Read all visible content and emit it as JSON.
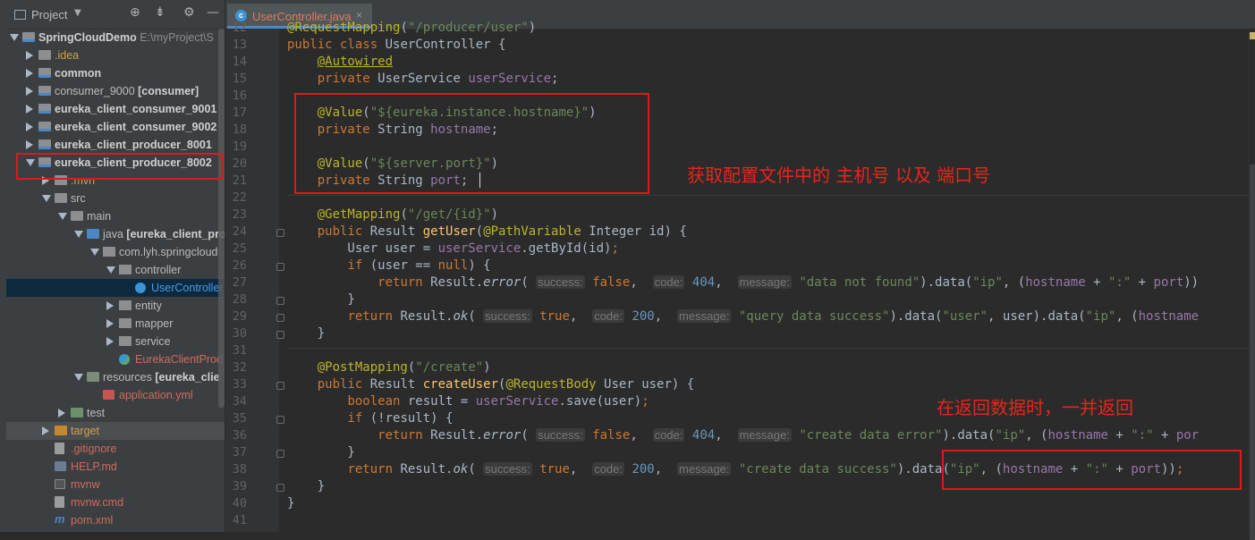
{
  "panel": {
    "title": "Project",
    "dropdown_icon": "chevron-down-icon",
    "toolbar_icons": [
      "crosshair-icon",
      "collapse-icon",
      "gear-icon",
      "minimize-icon"
    ]
  },
  "tree": [
    {
      "label": "SpringCloudDemo",
      "extra": " E:\\myProject\\S",
      "bold": true,
      "depth": 0,
      "arrow": "down",
      "icon": "module"
    },
    {
      "label": ".idea",
      "depth": 1,
      "arrow": "right",
      "icon": "folder",
      "color": "orange"
    },
    {
      "label": "common",
      "depth": 1,
      "arrow": "right",
      "icon": "module",
      "bold": true
    },
    {
      "label": "consumer_9000",
      "extra": " [consumer]",
      "depth": 1,
      "arrow": "right",
      "icon": "module"
    },
    {
      "label": "eureka_client_consumer_9001",
      "depth": 1,
      "arrow": "right",
      "icon": "module",
      "bold": true
    },
    {
      "label": "eureka_client_consumer_9002",
      "depth": 1,
      "arrow": "right",
      "icon": "module",
      "bold": true
    },
    {
      "label": "eureka_client_producer_8001",
      "depth": 1,
      "arrow": "right",
      "icon": "module",
      "bold": true
    },
    {
      "label": "eureka_client_producer_8002",
      "depth": 1,
      "arrow": "down",
      "icon": "module",
      "bold": true
    },
    {
      "label": ".mvn",
      "depth": 2,
      "arrow": "right",
      "icon": "folder",
      "color": "orange"
    },
    {
      "label": "src",
      "depth": 2,
      "arrow": "down",
      "icon": "folder"
    },
    {
      "label": "main",
      "depth": 3,
      "arrow": "down",
      "icon": "folder"
    },
    {
      "label": "java",
      "extra": " [eureka_client_pro",
      "depth": 4,
      "arrow": "down",
      "icon": "src"
    },
    {
      "label": "com.lyh.springcloud",
      "depth": 5,
      "arrow": "down",
      "icon": "pkg"
    },
    {
      "label": "controller",
      "depth": 6,
      "arrow": "down",
      "icon": "pkg"
    },
    {
      "label": "UserController",
      "depth": 7,
      "arrow": "none",
      "icon": "cls",
      "color": "sel",
      "selected": true
    },
    {
      "label": "entity",
      "depth": 6,
      "arrow": "right",
      "icon": "pkg"
    },
    {
      "label": "mapper",
      "depth": 6,
      "arrow": "right",
      "icon": "pkg"
    },
    {
      "label": "service",
      "depth": 6,
      "arrow": "right",
      "icon": "pkg"
    },
    {
      "label": "EurekaClientProd",
      "depth": 6,
      "arrow": "none",
      "icon": "app",
      "color": "red"
    },
    {
      "label": "resources",
      "extra": " [eureka_clie",
      "depth": 4,
      "arrow": "down",
      "icon": "res"
    },
    {
      "label": "application.yml",
      "depth": 5,
      "arrow": "none",
      "icon": "yml",
      "color": "red"
    },
    {
      "label": "test",
      "depth": 3,
      "arrow": "right",
      "icon": "test"
    },
    {
      "label": "target",
      "depth": 2,
      "arrow": "right",
      "icon": "target",
      "color": "orange",
      "highlight": true
    },
    {
      "label": ".gitignore",
      "depth": 2,
      "arrow": "none",
      "icon": "file",
      "color": "red"
    },
    {
      "label": "HELP.md",
      "depth": 2,
      "arrow": "none",
      "icon": "md",
      "color": "red"
    },
    {
      "label": "mvnw",
      "depth": 2,
      "arrow": "none",
      "icon": "term",
      "color": "red"
    },
    {
      "label": "mvnw.cmd",
      "depth": 2,
      "arrow": "none",
      "icon": "file",
      "color": "red"
    },
    {
      "label": "pom.xml",
      "depth": 2,
      "arrow": "none",
      "icon": "mvn",
      "color": "red"
    }
  ],
  "editor": {
    "tab": {
      "label": "UserController.java",
      "close": "×",
      "icon_letter": "c"
    },
    "lines": [
      {
        "n": "12",
        "html": "<span class=\"an\">@RequestMapping</span>(<span class=\"st\">\"/producer/user\"</span>)"
      },
      {
        "n": "13",
        "html": "<span class=\"kw\">public class</span> UserController {"
      },
      {
        "n": "14",
        "html": "    <span class=\"an underl\">@Autowired</span>"
      },
      {
        "n": "15",
        "html": "    <span class=\"kw\">private</span> UserService <span class=\"fd\">userService</span>;"
      },
      {
        "n": "16",
        "html": ""
      },
      {
        "n": "17",
        "html": "    <span class=\"an\">@Value</span>(<span class=\"st\">\"${eureka.instance.hostname}\"</span>)"
      },
      {
        "n": "18",
        "html": "    <span class=\"kw\">private</span> String <span class=\"fd\">hostname</span>;"
      },
      {
        "n": "19",
        "html": ""
      },
      {
        "n": "20",
        "html": "    <span class=\"an\">@Value</span>(<span class=\"st\">\"${server.port}\"</span>)"
      },
      {
        "n": "21",
        "html": "    <span class=\"kw\">private</span> String <span class=\"fd\">port</span>;"
      },
      {
        "n": "22",
        "html": ""
      },
      {
        "n": "23",
        "html": "    <span class=\"an\">@GetMapping</span>(<span class=\"st\">\"/get/{id}\"</span>)"
      },
      {
        "n": "24",
        "html": "    <span class=\"kw\">public</span> Result <span class=\"fn\">getUser</span>(<span class=\"an\">@PathVariable</span> Integer id) {"
      },
      {
        "n": "25",
        "html": "        User user = <span class=\"fd\">userService</span>.getById(id)<span class=\"kw\">;</span>"
      },
      {
        "n": "26",
        "html": "        <span class=\"kw\">if</span> (user == <span class=\"kw\">null</span>) {"
      },
      {
        "n": "27",
        "html": "            <span class=\"kw\">return</span> Result.<span class=\"it\">error</span>( <span class=\"hint\">success:</span> <span class=\"kw\">false</span>,  <span class=\"hint\">code:</span> <span class=\"nu\">404</span>,  <span class=\"hint\">message:</span> <span class=\"st\">\"data not found\"</span>).data(<span class=\"st\">\"ip\"</span>, (<span class=\"fd\">hostname</span> + <span class=\"st\">\":\"</span> + <span class=\"fd\">port</span>))"
      },
      {
        "n": "28",
        "html": "        }"
      },
      {
        "n": "29",
        "html": "        <span class=\"kw\">return</span> Result.<span class=\"it\">ok</span>( <span class=\"hint\">success:</span> <span class=\"kw\">true</span>,  <span class=\"hint\">code:</span> <span class=\"nu\">200</span>,  <span class=\"hint\">message:</span> <span class=\"st\">\"query data success\"</span>).data(<span class=\"st\">\"user\"</span>, user).data(<span class=\"st\">\"ip\"</span>, (<span class=\"fd\">hostname</span>"
      },
      {
        "n": "30",
        "html": "    }"
      },
      {
        "n": "31",
        "html": ""
      },
      {
        "n": "32",
        "html": "    <span class=\"an\">@PostMapping</span>(<span class=\"st\">\"/create\"</span>)"
      },
      {
        "n": "33",
        "html": "    <span class=\"kw\">public</span> Result <span class=\"fn\">createUser</span>(<span class=\"an\">@RequestBody</span> User user) {"
      },
      {
        "n": "34",
        "html": "        <span class=\"kw\">boolean</span> result = <span class=\"fd\">userService</span>.save(user)<span class=\"kw\">;</span>"
      },
      {
        "n": "35",
        "html": "        <span class=\"kw\">if</span> (!result) {"
      },
      {
        "n": "36",
        "html": "            <span class=\"kw\">return</span> Result.<span class=\"it\">error</span>( <span class=\"hint\">success:</span> <span class=\"kw\">false</span>,  <span class=\"hint\">code:</span> <span class=\"nu\">404</span>,  <span class=\"hint\">message:</span> <span class=\"st\">\"create data error\"</span>).data(<span class=\"st\">\"ip\"</span>, (<span class=\"fd\">hostname</span> + <span class=\"st\">\":\"</span> + <span class=\"fd\">por</span>"
      },
      {
        "n": "37",
        "html": "        }"
      },
      {
        "n": "38",
        "html": "        <span class=\"kw\">return</span> Result.<span class=\"it\">ok</span>( <span class=\"hint\">success:</span> <span class=\"kw\">true</span>,  <span class=\"hint\">code:</span> <span class=\"nu\">200</span>,  <span class=\"hint\">message:</span> <span class=\"st\">\"create data success\"</span>).data(<span class=\"st\">\"ip\"</span>, (<span class=\"fd\">hostname</span> + <span class=\"st\">\":\"</span> + <span class=\"fd\">port</span>))<span class=\"kw\">;</span>"
      },
      {
        "n": "39",
        "html": "    }"
      },
      {
        "n": "40",
        "html": "}"
      },
      {
        "n": "41",
        "html": ""
      }
    ]
  },
  "annotations": {
    "config_note": "获取配置文件中的 主机号 以及 端口号",
    "return_note": "在返回数据时，一并返回"
  },
  "colors": {
    "annotation_red": "#e0171b",
    "background": "#2b2b2b",
    "panel": "#3c3f41"
  }
}
